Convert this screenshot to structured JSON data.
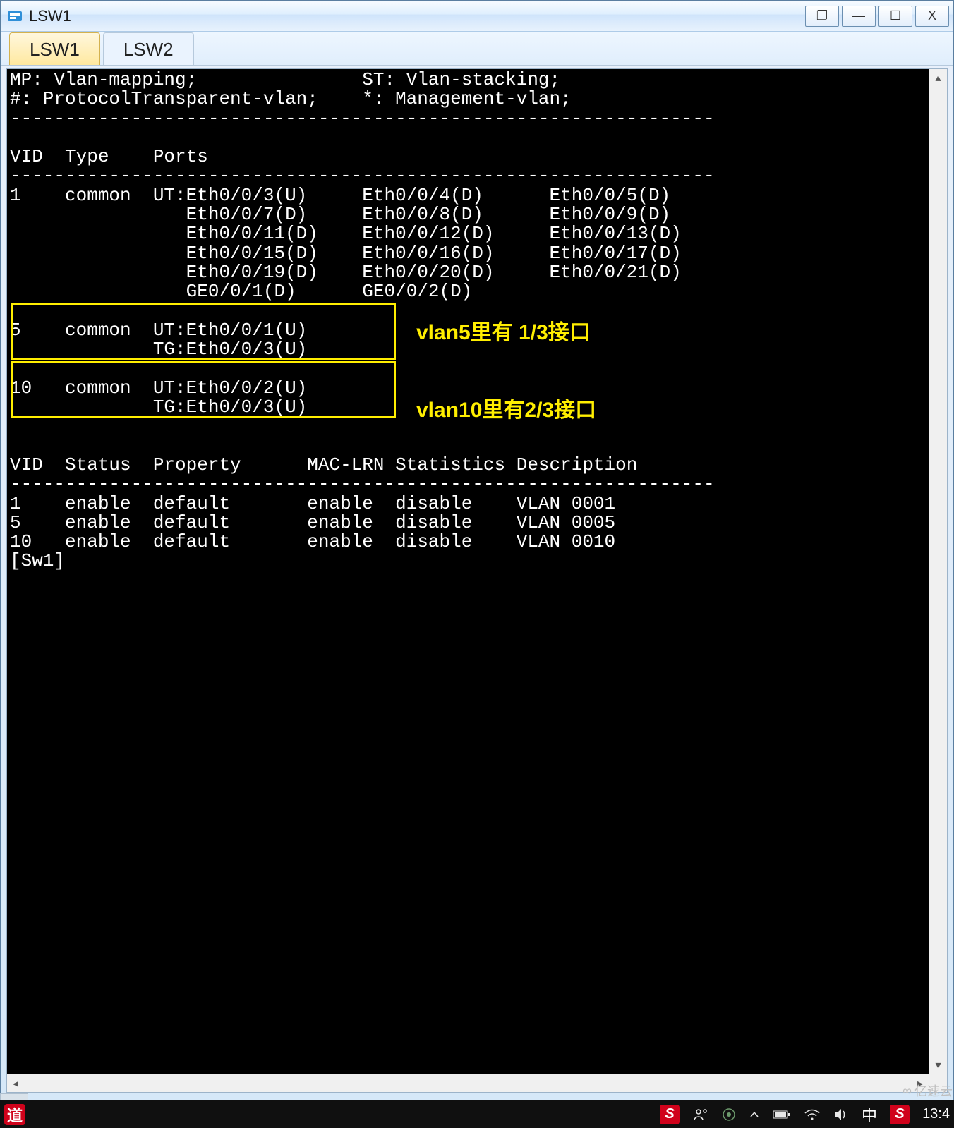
{
  "window": {
    "title": "LSW1",
    "tabs": [
      {
        "label": "LSW1",
        "active": true
      },
      {
        "label": "LSW2",
        "active": false
      }
    ],
    "controls": {
      "pop": "❐",
      "min": "—",
      "max": "☐",
      "close": "X"
    }
  },
  "terminal": {
    "legend": [
      "MP: Vlan-mapping;               ST: Vlan-stacking;",
      "#: ProtocolTransparent-vlan;    *: Management-vlan;"
    ],
    "ports_header": "VID  Type    Ports",
    "vlan_ports": [
      {
        "vid": "1",
        "type": "common",
        "rows": [
          "UT:Eth0/0/3(U)     Eth0/0/4(D)      Eth0/0/5(D)",
          "   Eth0/0/7(D)     Eth0/0/8(D)      Eth0/0/9(D)",
          "   Eth0/0/11(D)    Eth0/0/12(D)     Eth0/0/13(D)",
          "   Eth0/0/15(D)    Eth0/0/16(D)     Eth0/0/17(D)",
          "   Eth0/0/19(D)    Eth0/0/20(D)     Eth0/0/21(D)",
          "   GE0/0/1(D)      GE0/0/2(D)"
        ]
      },
      {
        "vid": "5",
        "type": "common",
        "rows": [
          "UT:Eth0/0/1(U)",
          "TG:Eth0/0/3(U)"
        ]
      },
      {
        "vid": "10",
        "type": "common",
        "rows": [
          "UT:Eth0/0/2(U)",
          "TG:Eth0/0/3(U)"
        ]
      }
    ],
    "status_header": "VID  Status  Property      MAC-LRN Statistics Description",
    "vlan_status": [
      {
        "vid": "1",
        "status": "enable",
        "property": "default",
        "mac": "enable",
        "stats": "disable",
        "desc": "VLAN 0001"
      },
      {
        "vid": "5",
        "status": "enable",
        "property": "default",
        "mac": "enable",
        "stats": "disable",
        "desc": "VLAN 0005"
      },
      {
        "vid": "10",
        "status": "enable",
        "property": "default",
        "mac": "enable",
        "stats": "disable",
        "desc": "VLAN 0010"
      }
    ],
    "prompt": "[Sw1]"
  },
  "annotations": {
    "note1": "vlan5里有 1/3接口",
    "note2": "vlan10里有2/3接口"
  },
  "taskbar": {
    "left_char": "道",
    "ime": "中",
    "clock": "13:4",
    "watermark": "亿速云"
  }
}
